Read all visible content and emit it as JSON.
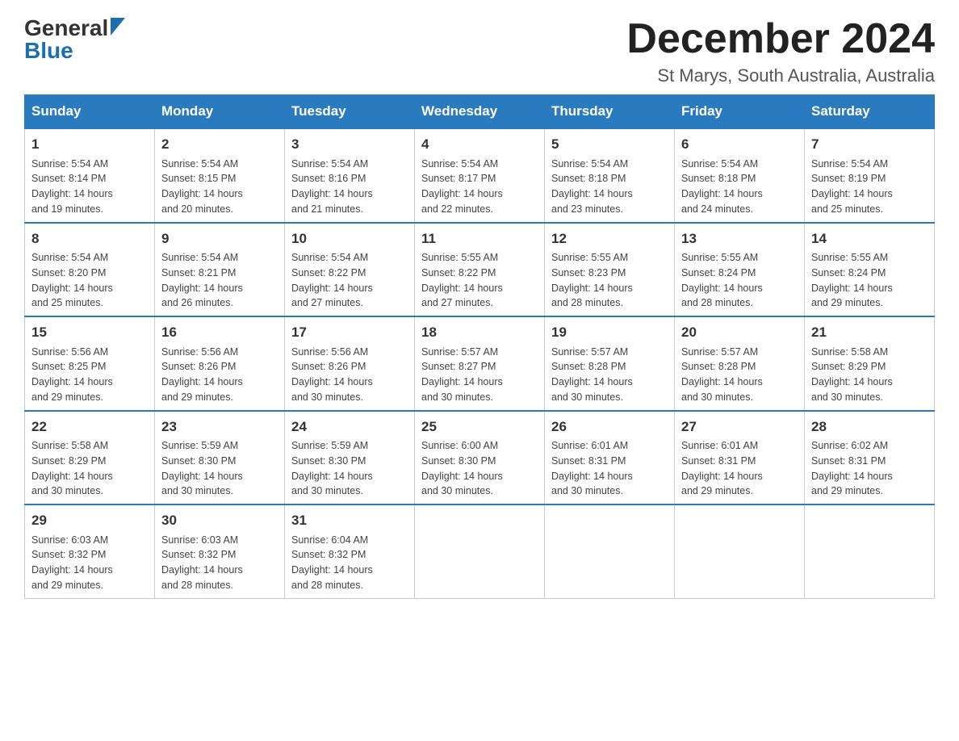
{
  "logo": {
    "general": "General",
    "blue": "Blue"
  },
  "header": {
    "month": "December 2024",
    "location": "St Marys, South Australia, Australia"
  },
  "weekdays": [
    "Sunday",
    "Monday",
    "Tuesday",
    "Wednesday",
    "Thursday",
    "Friday",
    "Saturday"
  ],
  "weeks": [
    [
      {
        "day": "1",
        "sunrise": "5:54 AM",
        "sunset": "8:14 PM",
        "daylight": "14 hours and 19 minutes."
      },
      {
        "day": "2",
        "sunrise": "5:54 AM",
        "sunset": "8:15 PM",
        "daylight": "14 hours and 20 minutes."
      },
      {
        "day": "3",
        "sunrise": "5:54 AM",
        "sunset": "8:16 PM",
        "daylight": "14 hours and 21 minutes."
      },
      {
        "day": "4",
        "sunrise": "5:54 AM",
        "sunset": "8:17 PM",
        "daylight": "14 hours and 22 minutes."
      },
      {
        "day": "5",
        "sunrise": "5:54 AM",
        "sunset": "8:18 PM",
        "daylight": "14 hours and 23 minutes."
      },
      {
        "day": "6",
        "sunrise": "5:54 AM",
        "sunset": "8:18 PM",
        "daylight": "14 hours and 24 minutes."
      },
      {
        "day": "7",
        "sunrise": "5:54 AM",
        "sunset": "8:19 PM",
        "daylight": "14 hours and 25 minutes."
      }
    ],
    [
      {
        "day": "8",
        "sunrise": "5:54 AM",
        "sunset": "8:20 PM",
        "daylight": "14 hours and 25 minutes."
      },
      {
        "day": "9",
        "sunrise": "5:54 AM",
        "sunset": "8:21 PM",
        "daylight": "14 hours and 26 minutes."
      },
      {
        "day": "10",
        "sunrise": "5:54 AM",
        "sunset": "8:22 PM",
        "daylight": "14 hours and 27 minutes."
      },
      {
        "day": "11",
        "sunrise": "5:55 AM",
        "sunset": "8:22 PM",
        "daylight": "14 hours and 27 minutes."
      },
      {
        "day": "12",
        "sunrise": "5:55 AM",
        "sunset": "8:23 PM",
        "daylight": "14 hours and 28 minutes."
      },
      {
        "day": "13",
        "sunrise": "5:55 AM",
        "sunset": "8:24 PM",
        "daylight": "14 hours and 28 minutes."
      },
      {
        "day": "14",
        "sunrise": "5:55 AM",
        "sunset": "8:24 PM",
        "daylight": "14 hours and 29 minutes."
      }
    ],
    [
      {
        "day": "15",
        "sunrise": "5:56 AM",
        "sunset": "8:25 PM",
        "daylight": "14 hours and 29 minutes."
      },
      {
        "day": "16",
        "sunrise": "5:56 AM",
        "sunset": "8:26 PM",
        "daylight": "14 hours and 29 minutes."
      },
      {
        "day": "17",
        "sunrise": "5:56 AM",
        "sunset": "8:26 PM",
        "daylight": "14 hours and 30 minutes."
      },
      {
        "day": "18",
        "sunrise": "5:57 AM",
        "sunset": "8:27 PM",
        "daylight": "14 hours and 30 minutes."
      },
      {
        "day": "19",
        "sunrise": "5:57 AM",
        "sunset": "8:28 PM",
        "daylight": "14 hours and 30 minutes."
      },
      {
        "day": "20",
        "sunrise": "5:57 AM",
        "sunset": "8:28 PM",
        "daylight": "14 hours and 30 minutes."
      },
      {
        "day": "21",
        "sunrise": "5:58 AM",
        "sunset": "8:29 PM",
        "daylight": "14 hours and 30 minutes."
      }
    ],
    [
      {
        "day": "22",
        "sunrise": "5:58 AM",
        "sunset": "8:29 PM",
        "daylight": "14 hours and 30 minutes."
      },
      {
        "day": "23",
        "sunrise": "5:59 AM",
        "sunset": "8:30 PM",
        "daylight": "14 hours and 30 minutes."
      },
      {
        "day": "24",
        "sunrise": "5:59 AM",
        "sunset": "8:30 PM",
        "daylight": "14 hours and 30 minutes."
      },
      {
        "day": "25",
        "sunrise": "6:00 AM",
        "sunset": "8:30 PM",
        "daylight": "14 hours and 30 minutes."
      },
      {
        "day": "26",
        "sunrise": "6:01 AM",
        "sunset": "8:31 PM",
        "daylight": "14 hours and 30 minutes."
      },
      {
        "day": "27",
        "sunrise": "6:01 AM",
        "sunset": "8:31 PM",
        "daylight": "14 hours and 29 minutes."
      },
      {
        "day": "28",
        "sunrise": "6:02 AM",
        "sunset": "8:31 PM",
        "daylight": "14 hours and 29 minutes."
      }
    ],
    [
      {
        "day": "29",
        "sunrise": "6:03 AM",
        "sunset": "8:32 PM",
        "daylight": "14 hours and 29 minutes."
      },
      {
        "day": "30",
        "sunrise": "6:03 AM",
        "sunset": "8:32 PM",
        "daylight": "14 hours and 28 minutes."
      },
      {
        "day": "31",
        "sunrise": "6:04 AM",
        "sunset": "8:32 PM",
        "daylight": "14 hours and 28 minutes."
      },
      null,
      null,
      null,
      null
    ]
  ],
  "labels": {
    "sunrise": "Sunrise: ",
    "sunset": "Sunset: ",
    "daylight": "Daylight: "
  }
}
